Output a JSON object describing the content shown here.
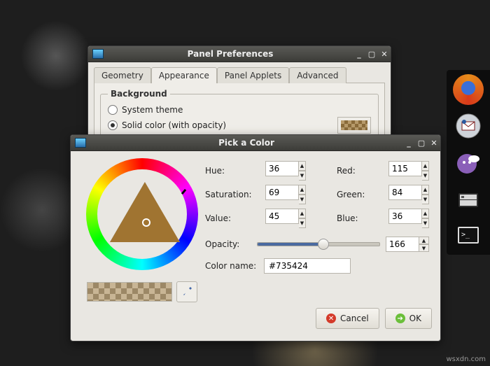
{
  "prefs_window": {
    "title": "Panel Preferences",
    "tabs": [
      "Geometry",
      "Appearance",
      "Panel Applets",
      "Advanced"
    ],
    "active_tab": 1,
    "group_title": "Background",
    "radio_system_label": "System theme",
    "radio_solid_label": "Solid color (with opacity)"
  },
  "picker_window": {
    "title": "Pick a Color",
    "labels": {
      "hue": "Hue:",
      "saturation": "Saturation:",
      "value": "Value:",
      "red": "Red:",
      "green": "Green:",
      "blue": "Blue:",
      "opacity": "Opacity:",
      "color_name": "Color name:"
    },
    "values": {
      "hue": "36",
      "saturation": "69",
      "value": "45",
      "red": "115",
      "green": "84",
      "blue": "36",
      "opacity": "166",
      "color_name": "#735424"
    },
    "buttons": {
      "cancel": "Cancel",
      "ok": "OK"
    }
  },
  "dock": {
    "items": [
      "firefox",
      "mail",
      "pidgin",
      "files",
      "terminal"
    ]
  },
  "watermark": "wsxdn.com"
}
